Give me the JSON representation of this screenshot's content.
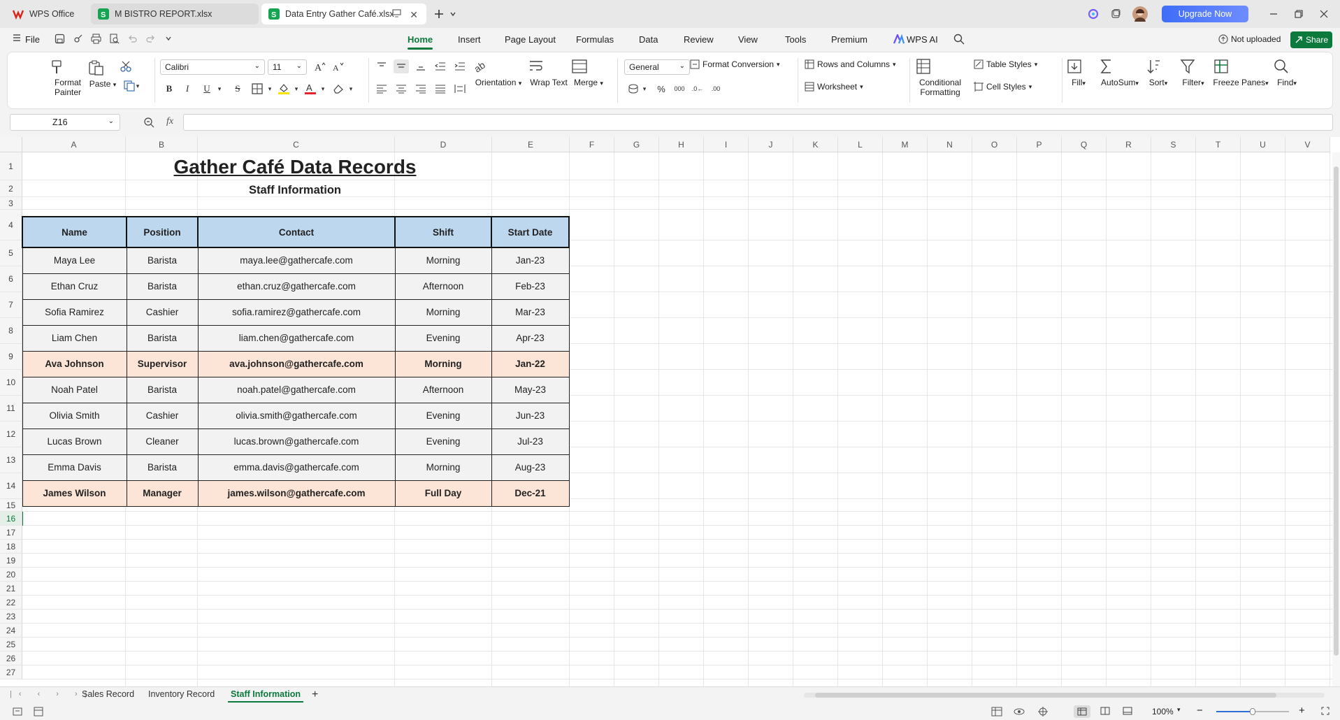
{
  "title_bar": {
    "tabs": [
      {
        "label": "WPS Office"
      },
      {
        "label": "M BISTRO REPORT.xlsx"
      },
      {
        "label": "Data Entry Gather Café.xlsx"
      }
    ],
    "upgrade_label": "Upgrade Now"
  },
  "menu": {
    "file_label": "File",
    "items": [
      "Home",
      "Insert",
      "Page Layout",
      "Formulas",
      "Data",
      "Review",
      "View",
      "Tools",
      "Premium",
      "WPS AI"
    ],
    "not_uploaded": "Not uploaded",
    "share": "Share"
  },
  "ribbon": {
    "format_painter": "Format Painter",
    "paste": "Paste",
    "font_name": "Calibri",
    "font_size": "11",
    "orientation": "Orientation",
    "wrap_text": "Wrap Text",
    "merge": "Merge",
    "number_format": "General",
    "format_conversion": "Format Conversion",
    "rows_columns": "Rows and Columns",
    "worksheet": "Worksheet",
    "conditional_formatting": "Conditional Formatting",
    "table_styles": "Table Styles",
    "cell_styles": "Cell Styles",
    "fill": "Fill",
    "autosum": "AutoSum",
    "sort": "Sort",
    "filter": "Filter",
    "freeze_panes": "Freeze Panes",
    "find": "Find",
    "bold": "B",
    "italic": "I",
    "underline": "U",
    "strike": "S",
    "font_color": "A"
  },
  "formula_bar": {
    "cell_ref": "Z16",
    "fx": "fx",
    "value": ""
  },
  "sheet": {
    "columns": [
      "A",
      "B",
      "C",
      "D",
      "E",
      "F",
      "G",
      "H",
      "I",
      "J",
      "K",
      "L",
      "M",
      "N",
      "O",
      "P",
      "Q",
      "R",
      "S",
      "T",
      "U",
      "V"
    ],
    "rows": [
      "1",
      "2",
      "3",
      "4",
      "5",
      "6",
      "7",
      "8",
      "9",
      "10",
      "11",
      "12",
      "13",
      "14",
      "15",
      "16",
      "17",
      "18",
      "19",
      "20",
      "21",
      "22",
      "23",
      "24",
      "25",
      "26",
      "27"
    ],
    "title": "Gather Café Data Records",
    "subtitle": "Staff Information",
    "headers": [
      "Name",
      "Position",
      "Contact",
      "Shift",
      "Start Date"
    ],
    "records": [
      [
        "Maya Lee",
        "Barista",
        "maya.lee@gathercafe.com",
        "Morning",
        "Jan-23"
      ],
      [
        "Ethan Cruz",
        "Barista",
        "ethan.cruz@gathercafe.com",
        "Afternoon",
        "Feb-23"
      ],
      [
        "Sofia Ramirez",
        "Cashier",
        "sofia.ramirez@gathercafe.com",
        "Morning",
        "Mar-23"
      ],
      [
        "Liam Chen",
        "Barista",
        "liam.chen@gathercafe.com",
        "Evening",
        "Apr-23"
      ],
      [
        "Ava Johnson",
        "Supervisor",
        "ava.johnson@gathercafe.com",
        "Morning",
        "Jan-22"
      ],
      [
        "Noah Patel",
        "Barista",
        "noah.patel@gathercafe.com",
        "Afternoon",
        "May-23"
      ],
      [
        "Olivia Smith",
        "Cashier",
        "olivia.smith@gathercafe.com",
        "Evening",
        "Jun-23"
      ],
      [
        "Lucas Brown",
        "Cleaner",
        "lucas.brown@gathercafe.com",
        "Evening",
        "Jul-23"
      ],
      [
        "Emma Davis",
        "Barista",
        "emma.davis@gathercafe.com",
        "Morning",
        "Aug-23"
      ],
      [
        "James Wilson",
        "Manager",
        "james.wilson@gathercafe.com",
        "Full Day",
        "Dec-21"
      ]
    ],
    "highlighted_rows": [
      4,
      9
    ],
    "header_fill": "#bdd7ee",
    "highlight_fill": "#fce4d6",
    "selected_row": "16"
  },
  "sheet_tabs": [
    "Sales Record",
    "Inventory Record",
    "Staff Information"
  ],
  "active_sheet": "Staff Information",
  "status": {
    "zoom": "100%"
  },
  "colors": {
    "accent": "#0d7a3d",
    "upgrade": "#4a73f7"
  }
}
